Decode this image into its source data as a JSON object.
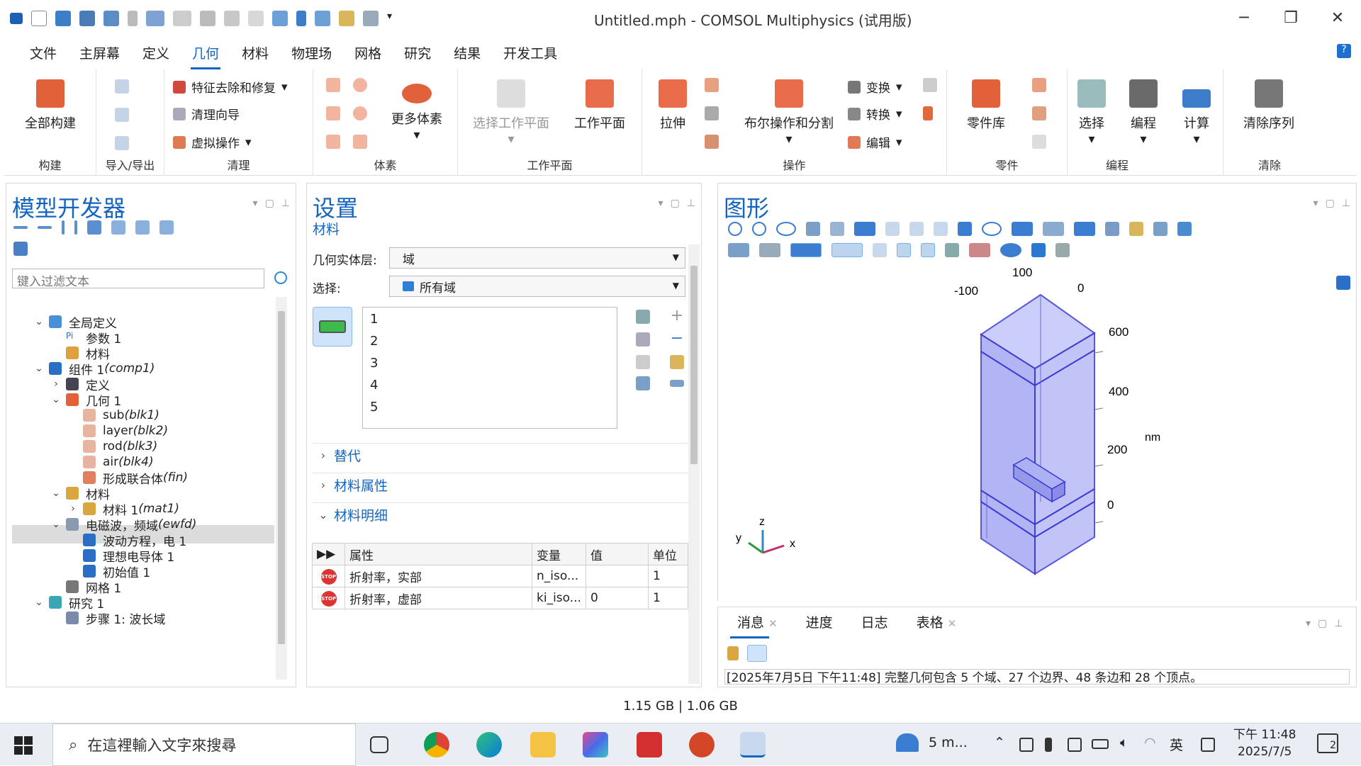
{
  "window": {
    "title": "Untitled.mph - COMSOL Multiphysics (试用版)",
    "minimize": "─",
    "restore": "❐",
    "close": "✕"
  },
  "menu": [
    "文件",
    "主屏幕",
    "定义",
    "几何",
    "材料",
    "物理场",
    "网格",
    "研究",
    "结果",
    "开发工具"
  ],
  "help": "?",
  "ribbon": {
    "groups": [
      "构建",
      "导入/导出",
      "清理",
      "体素",
      "工作平面",
      "操作",
      "零件",
      "编程",
      "清除"
    ],
    "build_all": "全部构建",
    "feature_remove": "特征去除和修复",
    "clean_wizard": "清理向导",
    "virtual_ops": "虚拟操作",
    "more_primitives": "更多体素",
    "select_workplane": "选择工作平面",
    "workplane": "工作平面",
    "extrude": "拉伸",
    "boolean": "布尔操作和分割",
    "transform": "变换",
    "convert": "转换",
    "edit": "编辑",
    "parts_lib": "零件库",
    "select": "选择",
    "programming": "编程",
    "calculate": "计算",
    "clear_sequence": "清除序列"
  },
  "model_builder": {
    "title": "模型开发器",
    "filter_placeholder": "键入过滤文本",
    "tree": [
      {
        "label": "全局定义",
        "it": "",
        "indent": 0,
        "toggle": "⌄"
      },
      {
        "label": "参数 1",
        "it": "",
        "indent": 1,
        "toggle": "",
        "icon_text": "Pi"
      },
      {
        "label": "材料",
        "it": "",
        "indent": 1,
        "toggle": ""
      },
      {
        "label": "组件 1 ",
        "it": "(comp1)",
        "indent": 0,
        "toggle": "⌄"
      },
      {
        "label": "定义",
        "it": "",
        "indent": 1,
        "toggle": "›"
      },
      {
        "label": "几何 1",
        "it": "",
        "indent": 1,
        "toggle": "⌄"
      },
      {
        "label": "sub ",
        "it": "(blk1)",
        "indent": 2,
        "toggle": ""
      },
      {
        "label": "layer ",
        "it": "(blk2)",
        "indent": 2,
        "toggle": ""
      },
      {
        "label": "rod ",
        "it": "(blk3)",
        "indent": 2,
        "toggle": ""
      },
      {
        "label": "air ",
        "it": "(blk4)",
        "indent": 2,
        "toggle": ""
      },
      {
        "label": "形成联合体 ",
        "it": "(fin)",
        "indent": 2,
        "toggle": ""
      },
      {
        "label": "材料",
        "it": "",
        "indent": 1,
        "toggle": "⌄"
      },
      {
        "label": "材料 1 ",
        "it": "(mat1)",
        "indent": 2,
        "toggle": "›"
      },
      {
        "label": "电磁波，频域 ",
        "it": "(ewfd)",
        "indent": 1,
        "toggle": "⌄"
      },
      {
        "label": "波动方程，电 1",
        "it": "",
        "indent": 2,
        "toggle": ""
      },
      {
        "label": "理想电导体 1",
        "it": "",
        "indent": 2,
        "toggle": ""
      },
      {
        "label": "初始值 1",
        "it": "",
        "indent": 2,
        "toggle": ""
      },
      {
        "label": "网格 1",
        "it": "",
        "indent": 1,
        "toggle": ""
      },
      {
        "label": "研究 1",
        "it": "",
        "indent": 0,
        "toggle": "⌄"
      },
      {
        "label": "步骤 1: 波长域",
        "it": "",
        "indent": 1,
        "toggle": ""
      }
    ]
  },
  "settings": {
    "title": "设置",
    "subtitle": "材料",
    "geom_level_label": "几何实体层:",
    "geom_level_value": "域",
    "selection_label": "选择:",
    "selection_value": "所有域",
    "domains": [
      "1",
      "2",
      "3",
      "4",
      "5"
    ],
    "sections": [
      "替代",
      "材料属性",
      "材料明细"
    ],
    "table": {
      "headers": [
        "属性",
        "变量",
        "值",
        "单位"
      ],
      "rows": [
        {
          "property": "折射率，实部",
          "variable": "n_iso...",
          "value": "",
          "unit": "1"
        },
        {
          "property": "折射率，虚部",
          "variable": "ki_iso...",
          "value": "0",
          "unit": "1"
        }
      ],
      "stop_label": "STOP"
    }
  },
  "graphics": {
    "title": "图形",
    "axis_labels": {
      "-100": "-100",
      "100": "100",
      "0top": "0",
      "600": "600",
      "400": "400",
      "200": "200",
      "0": "0",
      "unit": "nm"
    },
    "triad": {
      "z": "z",
      "y": "y",
      "x": "x"
    }
  },
  "messages": {
    "tabs": [
      "消息",
      "进度",
      "日志",
      "表格"
    ],
    "close": "✕",
    "text": "[2025年7月5日 下午11:48] 完整几何包含 5 个域、27 个边界、48 条边和 28 个顶点。"
  },
  "status": {
    "memory": "1.15 GB | 1.06 GB"
  },
  "taskbar": {
    "search_placeholder": "在這裡輸入文字來搜尋",
    "weather": "5 m...",
    "ime": "英",
    "time": "下午 11:48",
    "date": "2025/7/5",
    "notif": "2"
  },
  "colors": {
    "accent": "#1565c0",
    "model": "#8a8cf0"
  }
}
